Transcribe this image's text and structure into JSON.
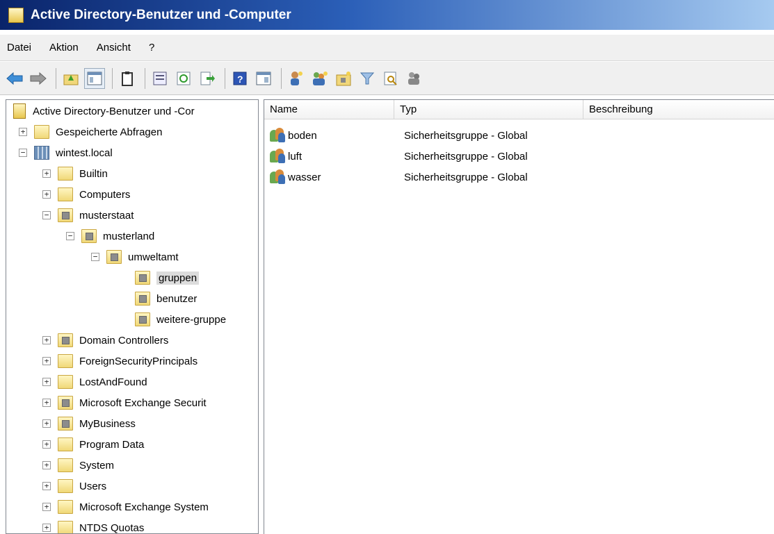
{
  "window": {
    "title": "Active Directory-Benutzer und -Computer"
  },
  "menu": {
    "items": [
      "Datei",
      "Aktion",
      "Ansicht",
      "?"
    ]
  },
  "toolbar": {
    "buttons": [
      "back-arrow-icon",
      "forward-arrow-icon",
      "up-folder-icon",
      "show-hide-tree-icon",
      "clipboard-icon",
      "properties-icon",
      "refresh-icon",
      "export-list-icon",
      "help-icon",
      "console-icon",
      "new-user-icon",
      "new-group-icon",
      "new-ou-icon",
      "filter-icon",
      "find-icon",
      "add-to-group-icon"
    ]
  },
  "tree": {
    "root": "Active Directory-Benutzer und -Cor",
    "saved_queries": "Gespeicherte Abfragen",
    "domain": "wintest.local",
    "builtin": "Builtin",
    "computers": "Computers",
    "musterstaat": "musterstaat",
    "musterland": "musterland",
    "umweltamt": "umweltamt",
    "gruppen": "gruppen",
    "benutzer": "benutzer",
    "weitere_gruppe": "weitere-gruppe",
    "domain_controllers": "Domain Controllers",
    "foreign": "ForeignSecurityPrincipals",
    "lostandfound": "LostAndFound",
    "ms_exchange_security": "Microsoft Exchange Securit",
    "mybusiness": "MyBusiness",
    "program_data": "Program Data",
    "system": "System",
    "users": "Users",
    "ms_exchange_system": "Microsoft Exchange System",
    "ntds_quotas": "NTDS Quotas"
  },
  "list": {
    "columns": {
      "name": "Name",
      "type": "Typ",
      "description": "Beschreibung"
    },
    "rows": [
      {
        "name": "boden",
        "type": "Sicherheitsgruppe - Global",
        "description": ""
      },
      {
        "name": "luft",
        "type": "Sicherheitsgruppe - Global",
        "description": ""
      },
      {
        "name": "wasser",
        "type": "Sicherheitsgruppe - Global",
        "description": ""
      }
    ]
  }
}
